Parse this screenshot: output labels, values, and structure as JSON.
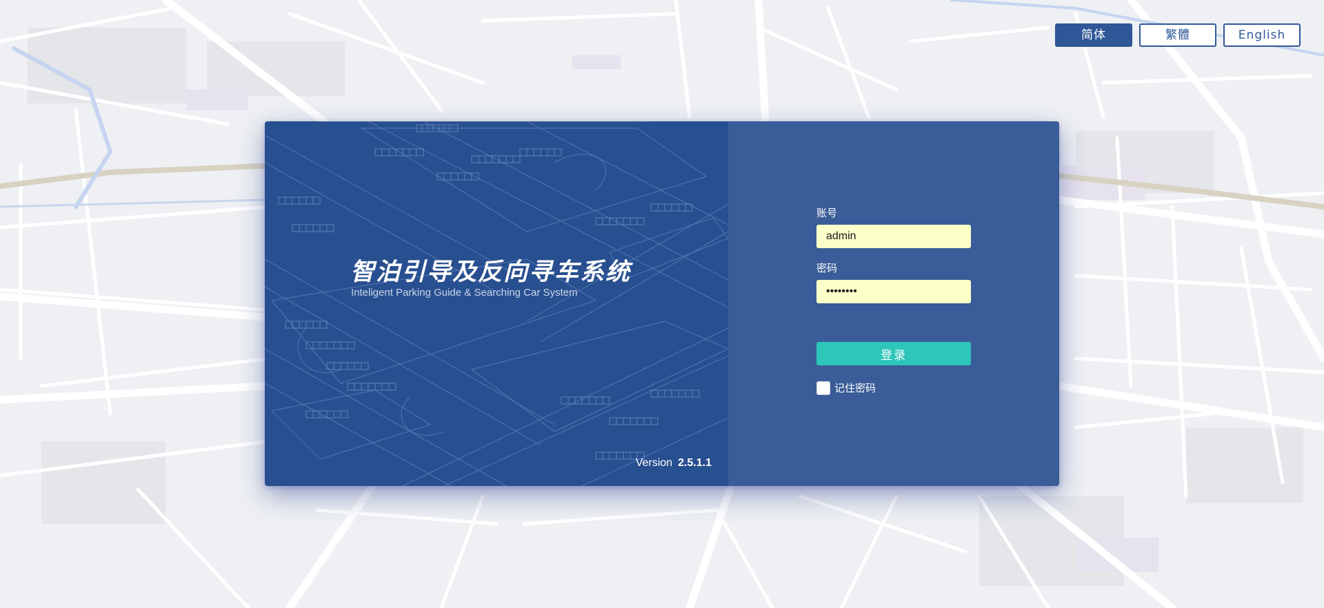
{
  "language_switcher": {
    "options": [
      "简体",
      "繁體",
      "English"
    ],
    "active": "简体"
  },
  "branding": {
    "title": "智泊引导及反向寻车系统",
    "subtitle": "Inteligent Parking Guide & Searching Car System",
    "version_label": "Version",
    "version_number": "2.5.1.1"
  },
  "login": {
    "account_label": "账号",
    "account_value": "admin",
    "password_label": "密码",
    "password_value": "••••••••",
    "submit_label": "登录",
    "remember_label": "记住密码",
    "remember_checked": false
  },
  "colors": {
    "brand_dark": "#284f8f",
    "form_panel": "#3a5c98",
    "accent_button": "#2ec5bb",
    "input_fill": "#fbffc8",
    "lang_border": "#2f5797"
  }
}
